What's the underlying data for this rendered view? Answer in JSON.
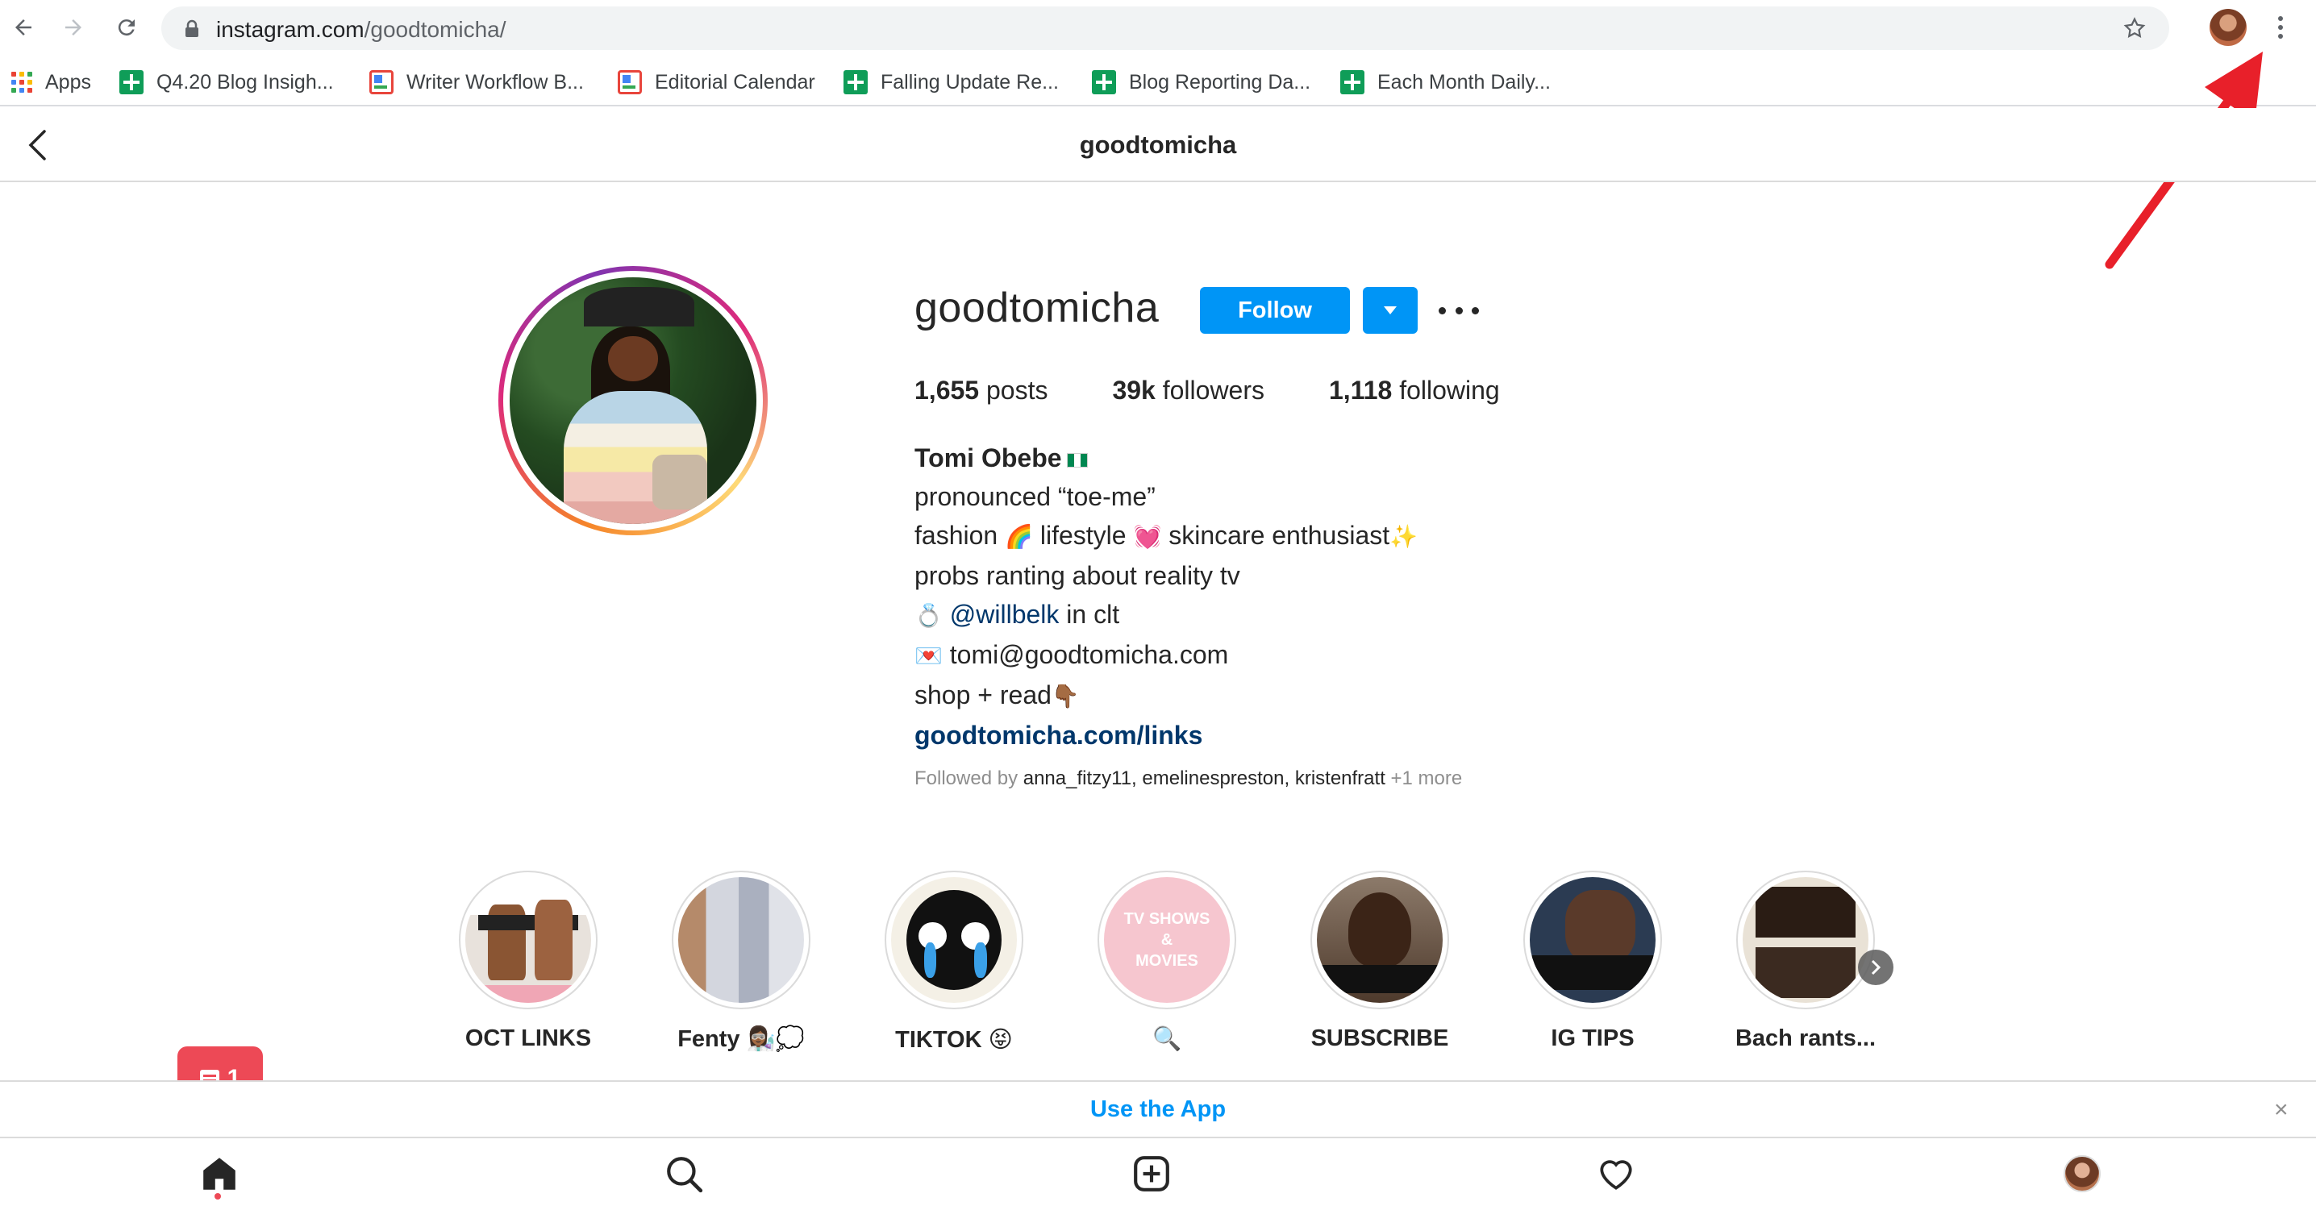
{
  "browser": {
    "url_host": "instagram.com",
    "url_path": "/goodtomicha/",
    "bookmarks": [
      {
        "label": "Apps",
        "icon": "apps-grid-icon"
      },
      {
        "label": "Q4.20 Blog Insigh...",
        "icon": "sheets-icon"
      },
      {
        "label": "Writer Workflow B...",
        "icon": "doc-icon"
      },
      {
        "label": "Editorial Calendar",
        "icon": "doc-icon"
      },
      {
        "label": "Falling Update Re...",
        "icon": "sheets-icon"
      },
      {
        "label": "Blog Reporting Da...",
        "icon": "sheets-icon"
      },
      {
        "label": "Each Month Daily...",
        "icon": "sheets-icon"
      }
    ]
  },
  "header": {
    "title": "goodtomicha"
  },
  "profile": {
    "username": "goodtomicha",
    "follow_label": "Follow",
    "stats": [
      {
        "value": "1,655",
        "label": "posts"
      },
      {
        "value": "39k",
        "label": "followers"
      },
      {
        "value": "1,118",
        "label": "following"
      }
    ],
    "name": "Tomi Obebe",
    "bio": {
      "line1": "pronounced “toe-me”",
      "line2_a": "fashion ",
      "line2_emoji1": "🌈",
      "line2_b": " lifestyle ",
      "line2_emoji2": "💓",
      "line2_c": " skincare enthusiast",
      "line2_emoji3": "✨",
      "line3": "probs ranting about reality tv",
      "line4_emoji": "💍",
      "line4_mention": "@willbelk",
      "line4_rest": " in clt",
      "line5_emoji": "💌",
      "line5_text": "tomi@goodtomicha.com",
      "line6_text": "shop + read",
      "line6_emoji": "👇🏾",
      "link": "goodtomicha.com/links"
    },
    "followed_by": {
      "prefix": "Followed by ",
      "users": "anna_fitzy11, emelinespreston, kristenfratt",
      "more": " +1 more"
    }
  },
  "highlights": [
    {
      "label": "OCT LINKS"
    },
    {
      "label": "Fenty 👩🏾‍🔬💭"
    },
    {
      "label": "TIKTOK 😝"
    },
    {
      "label": "🔍",
      "thumb_text": [
        "TV SHOWS",
        "&",
        "MOVIES"
      ]
    },
    {
      "label": "SUBSCRIBE"
    },
    {
      "label": "IG TIPS"
    },
    {
      "label": "Bach rants..."
    }
  ],
  "use_app_banner": {
    "text": "Use the App",
    "close": "×"
  },
  "notification": {
    "count": "1"
  },
  "colors": {
    "follow_blue": "#0095f6",
    "link_blue": "#00376b",
    "notif_red": "#ed4956",
    "arrow_red": "#e8202a"
  }
}
